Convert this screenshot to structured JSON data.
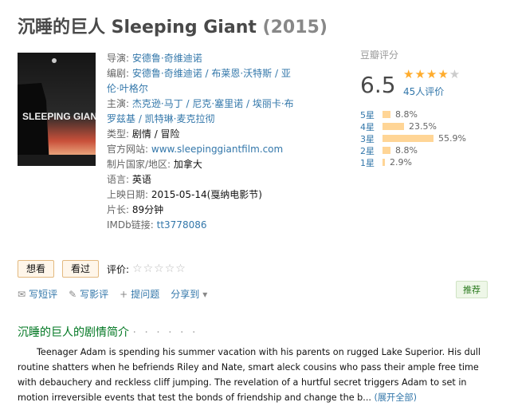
{
  "title": {
    "name": "沉睡的巨人 Sleeping Giant",
    "year": "(2015)"
  },
  "poster": {
    "text_main": "SLEEPING GIANT"
  },
  "info": {
    "director_label": "导演:",
    "director": "安德鲁·奇维迪诺",
    "writer_label": "编剧:",
    "writers": "安德鲁·奇维迪诺 / 布莱恩·沃特斯 / 亚伦·叶格尔",
    "cast_label": "主演:",
    "cast": "杰克逊·马丁 / 尼克·塞里诺 / 埃丽卡·布罗兹基 / 凯特琳·麦克拉彻",
    "genre_label": "类型:",
    "genre": "剧情 / 冒险",
    "site_label": "官方网站:",
    "site": "www.sleepinggiantfilm.com",
    "country_label": "制片国家/地区:",
    "country": "加拿大",
    "language_label": "语言:",
    "language": "英语",
    "release_label": "上映日期:",
    "release": "2015-05-14(戛纳电影节)",
    "runtime_label": "片长:",
    "runtime": "89分钟",
    "imdb_label": "IMDb链接:",
    "imdb": "tt3778086"
  },
  "rating": {
    "header": "豆瓣评分",
    "score": "6.5",
    "stars_value": 3.5,
    "people": "45人评价",
    "bars": [
      {
        "label": "5星",
        "pct": "8.8%",
        "value": 8.8
      },
      {
        "label": "4星",
        "pct": "23.5%",
        "value": 23.5
      },
      {
        "label": "3星",
        "pct": "55.9%",
        "value": 55.9
      },
      {
        "label": "2星",
        "pct": "8.8%",
        "value": 8.8
      },
      {
        "label": "1星",
        "pct": "2.9%",
        "value": 2.9
      }
    ]
  },
  "buttons": {
    "want": "想看",
    "seen": "看过",
    "rate_label": "评价:"
  },
  "actions": {
    "short_review": "写短评",
    "review": "写影评",
    "ask": "提问题",
    "share": "分享到"
  },
  "recommend": "推荐",
  "summary": {
    "heading": "沉睡的巨人的剧情简介",
    "dots": "· · · · · ·",
    "text": "Teenager Adam is spending his summer vacation with his parents on rugged Lake Superior. His dull routine shatters when he befriends Riley and Nate, smart aleck cousins who pass their ample free time with debauchery and reckless cliff jumping. The revelation of a hurtful secret triggers Adam to set in motion irreversible events that test the bonds of friendship and change the b...",
    "more": "(展开全部)"
  }
}
